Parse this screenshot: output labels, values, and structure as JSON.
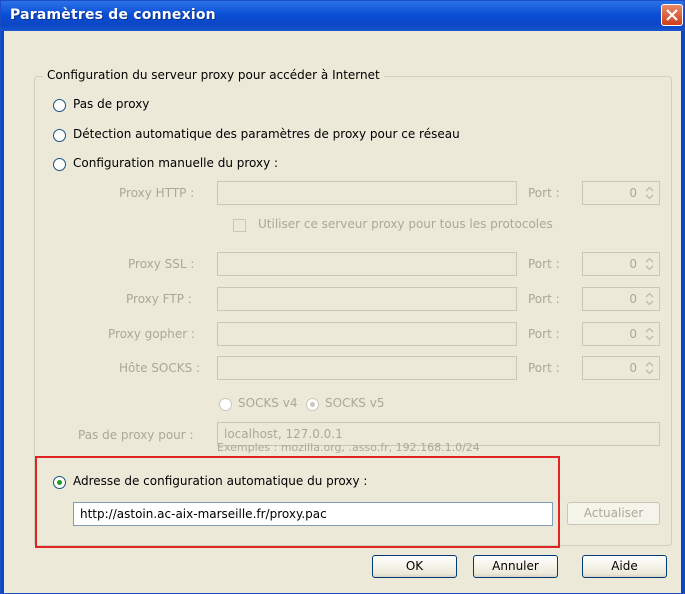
{
  "window": {
    "title": "Paramètres de connexion"
  },
  "group": {
    "legend": "Configuration du serveur proxy pour accéder à Internet"
  },
  "options": {
    "no_proxy": "Pas de proxy",
    "auto_detect": "Détection automatique des paramètres de proxy pour ce réseau",
    "manual": "Configuration manuelle du proxy :",
    "auto_config": "Adresse de configuration automatique du proxy :"
  },
  "manual": {
    "http_label": "Proxy HTTP :",
    "port_label": "Port :",
    "port_value": "0",
    "use_for_all": "Utiliser ce serveur proxy pour tous les protocoles",
    "ssl_label": "Proxy SSL :",
    "ftp_label": "Proxy FTP :",
    "gopher_label": "Proxy gopher :",
    "socks_label": "Hôte SOCKS :",
    "socks_v4": "SOCKS v4",
    "socks_v5": "SOCKS v5",
    "no_proxy_for_label": "Pas de proxy pour :",
    "no_proxy_for_value": "localhost, 127.0.0.1",
    "example": "Exemples : mozilla.org, .asso.fr, 192.168.1.0/24"
  },
  "auto_config": {
    "url": "http://astoin.ac-aix-marseille.fr/proxy.pac",
    "reload_button": "Actualiser"
  },
  "buttons": {
    "ok": "OK",
    "cancel": "Annuler",
    "help": "Aide"
  }
}
